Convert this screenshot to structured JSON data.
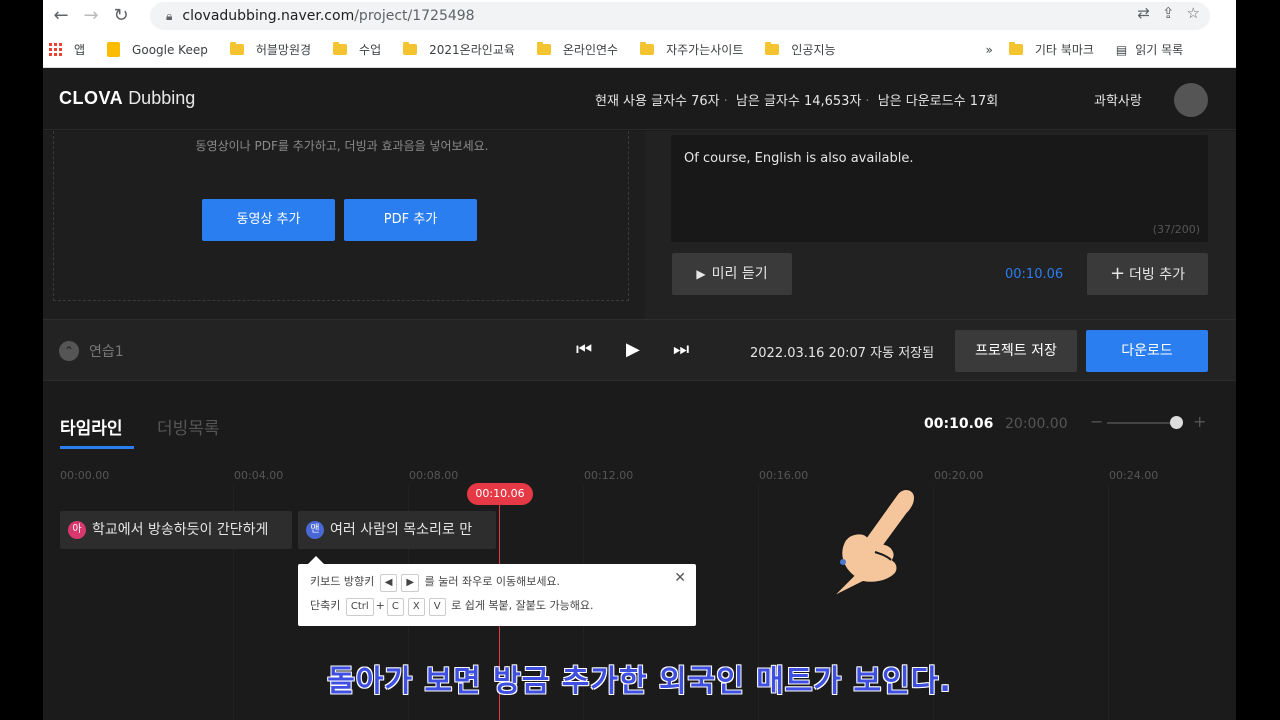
{
  "browser": {
    "url_host": "clovadubbing.naver.com",
    "url_path": "/project/1725498"
  },
  "bookmarks": [
    {
      "label": "앱",
      "icon": "apps-grid-icon"
    },
    {
      "label": "Google Keep",
      "icon": "keep-icon"
    },
    {
      "label": "허블망원경",
      "icon": "folder-icon"
    },
    {
      "label": "수업",
      "icon": "folder-icon"
    },
    {
      "label": "2021온라인교육",
      "icon": "folder-icon"
    },
    {
      "label": "온라인연수",
      "icon": "folder-icon"
    },
    {
      "label": "자주가는사이트",
      "icon": "folder-icon"
    },
    {
      "label": "인공지능",
      "icon": "folder-icon"
    },
    {
      "label": "»",
      "icon": ""
    },
    {
      "label": "기타 북마크",
      "icon": "folder-icon"
    },
    {
      "label": "읽기 목록",
      "icon": "reading-list-icon"
    }
  ],
  "header": {
    "logo_bold": "CLOVA",
    "logo_light": "Dubbing",
    "stat_used": "현재 사용 글자수 76자",
    "stat_remaining": "남은 글자수 14,653자",
    "stat_downloads": "남은 다운로드수 17회",
    "user_name": "과학사랑"
  },
  "media_panel": {
    "hint": "동영상이나 PDF를 추가하고, 더빙과 효과음을 넣어보세요.",
    "add_video": "동영상 추가",
    "add_pdf": "PDF 추가"
  },
  "dub_panel": {
    "text": "Of course, English is also available.",
    "char_count": "(37/200)",
    "preview_label": "미리 듣기",
    "duration": "00:10.06",
    "add_dub_label": "더빙 추가"
  },
  "project_bar": {
    "project_name": "연습1",
    "saved_at": "2022.03.16 20:07 자동 저장됨",
    "save_label": "프로젝트 저장",
    "download_label": "다운로드"
  },
  "timeline": {
    "tab_timeline": "타임라인",
    "tab_dub_list": "더빙목록",
    "current_time": "00:10.06",
    "total_time": "20:00.00",
    "ruler": [
      "00:00.00",
      "00:04.00",
      "00:08.00",
      "00:12.00",
      "00:16.00",
      "00:20.00",
      "00:24.00"
    ],
    "playhead_label": "00:10.06",
    "clips": [
      {
        "badge": "아",
        "badge_color": "#d9386e",
        "text": "학교에서 방송하듯이 간단하게"
      },
      {
        "badge": "맨",
        "badge_color": "#4a67d6",
        "text": "여러 사람의 목소리로 만"
      }
    ]
  },
  "tooltip": {
    "line1_a": "키보드 방향키",
    "key_left": "◀",
    "key_right": "▶",
    "line1_b": "를 눌러 좌우로 이동해보세요.",
    "line2_a": "단축키",
    "key_ctrl": "Ctrl",
    "key_plus": "+",
    "key_c": "C",
    "key_x": "X",
    "key_v": "V",
    "line2_b": "로 쉽게 복붙, 잘붙도 가능해요."
  },
  "subtitle": "돌아가 보면 방금 추가한 외국인 매트가 보인다."
}
